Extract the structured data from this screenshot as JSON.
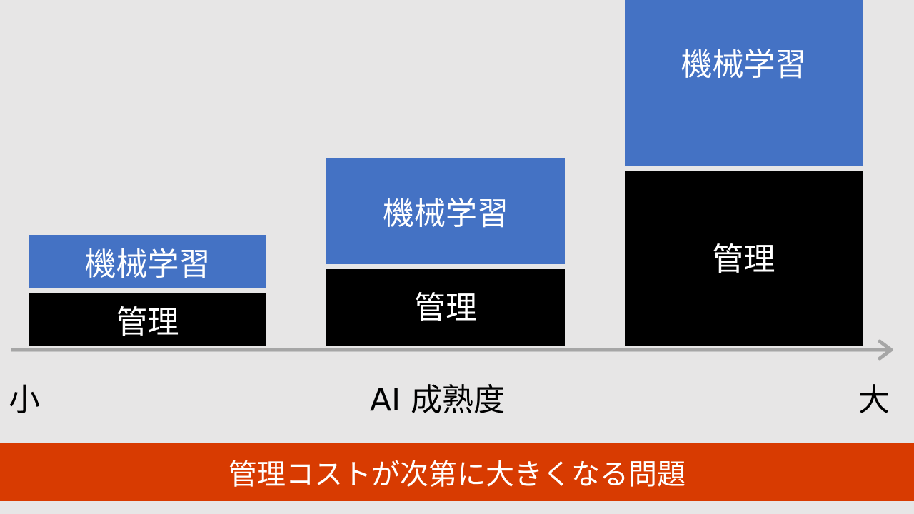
{
  "columns": [
    {
      "ml_label": "機械学習",
      "mg_label": "管理"
    },
    {
      "ml_label": "機械学習",
      "mg_label": "管理"
    },
    {
      "ml_label": "機械学習",
      "mg_label": "管理"
    }
  ],
  "axis": {
    "min_label": "小",
    "title": "AI 成熟度",
    "max_label": "大"
  },
  "banner": {
    "text": "管理コストが次第に大きくなる問題"
  },
  "colors": {
    "background": "#e7e6e6",
    "ml_block": "#4472c4",
    "management_block": "#000000",
    "axis_arrow": "#a6a6a6",
    "banner": "#d83b01",
    "text_on_block": "#ffffff"
  }
}
